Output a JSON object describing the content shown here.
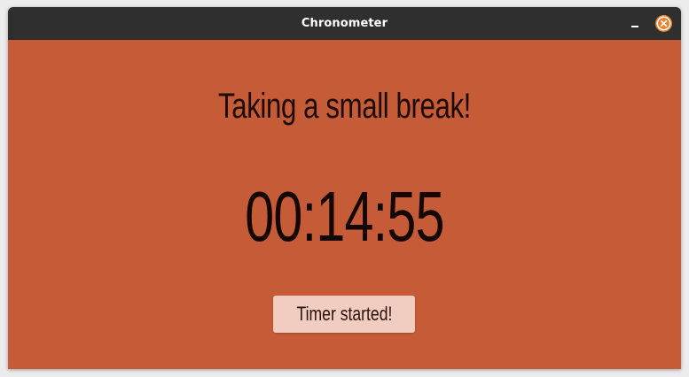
{
  "window": {
    "title": "Chronometer",
    "controls": {
      "minimize_icon": "minimize-icon",
      "close_icon": "close-icon"
    }
  },
  "main": {
    "headline": "Taking a small break!",
    "timer": "00:14:55",
    "status_button_label": "Timer started!"
  },
  "colors": {
    "background": "#c55b37",
    "titlebar": "#2f2f2f",
    "close_button": "#e9832f",
    "status_button": "#f1cdc1",
    "text_dark": "#140703"
  }
}
